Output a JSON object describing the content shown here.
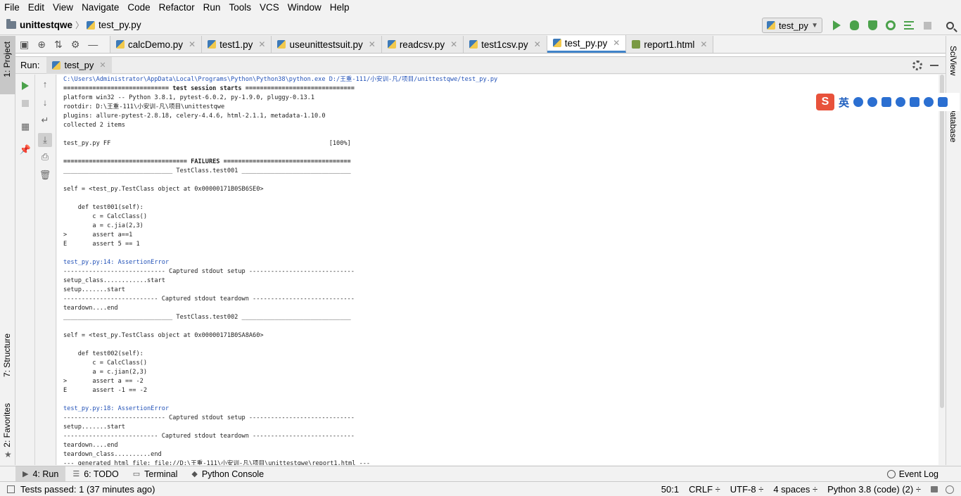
{
  "menu": [
    "File",
    "Edit",
    "View",
    "Navigate",
    "Code",
    "Refactor",
    "Run",
    "Tools",
    "VCS",
    "Window",
    "Help"
  ],
  "breadcrumb": {
    "project": "unittestqwe",
    "file": "test_py.py"
  },
  "run_config": {
    "label": "test_py"
  },
  "left_strip": {
    "project": "1: Project",
    "structure": "7: Structure",
    "favorites": "2: Favorites"
  },
  "right_strip": {
    "sciview": "SciView",
    "database": "Database"
  },
  "editor_tabs": [
    {
      "label": "calcDemo.py",
      "icon": "python-file-icon"
    },
    {
      "label": "test1.py",
      "icon": "python-file-icon"
    },
    {
      "label": "useunittestsuit.py",
      "icon": "python-file-icon"
    },
    {
      "label": "readcsv.py",
      "icon": "python-file-icon"
    },
    {
      "label": "test1csv.py",
      "icon": "python-file-icon"
    },
    {
      "label": "test_py.py",
      "icon": "python-file-icon",
      "active": true
    },
    {
      "label": "report1.html",
      "icon": "html-file-icon"
    }
  ],
  "run_panel": {
    "label": "Run:",
    "tab": "test_py"
  },
  "console_lines": [
    {
      "t": "C:\\Users\\Administrator\\AppData\\Local\\Programs\\Python\\Python38\\python.exe D:/王重-111/小安训-凡/项目/unittestqwe/test_py.py",
      "c": "link"
    },
    {
      "t": "============================= test session starts ==============================",
      "c": "bold"
    },
    {
      "t": "platform win32 -- Python 3.8.1, pytest-6.0.2, py-1.9.0, pluggy-0.13.1",
      "c": ""
    },
    {
      "t": "rootdir: D:\\王重-111\\小安训-凡\\项目\\unittestqwe",
      "c": ""
    },
    {
      "t": "plugins: allure-pytest-2.8.18, celery-4.4.6, html-2.1.1, metadata-1.10.0",
      "c": ""
    },
    {
      "t": "collected 2 items",
      "c": ""
    },
    {
      "t": "",
      "c": ""
    },
    {
      "t": "test_py.py FF                                                            [100%]",
      "c": ""
    },
    {
      "t": "",
      "c": ""
    },
    {
      "t": "================================== FAILURES ===================================",
      "c": "bold"
    },
    {
      "t": "______________________________ TestClass.test001 ______________________________",
      "c": ""
    },
    {
      "t": "",
      "c": ""
    },
    {
      "t": "self = <test_py.TestClass object at 0x00000171B0SB6SE0>",
      "c": ""
    },
    {
      "t": "",
      "c": ""
    },
    {
      "t": "    def test001(self):",
      "c": ""
    },
    {
      "t": "        c = CalcClass()",
      "c": ""
    },
    {
      "t": "        a = c.jia(2,3)",
      "c": ""
    },
    {
      "t": ">       assert a==1",
      "c": ""
    },
    {
      "t": "E       assert 5 == 1",
      "c": ""
    },
    {
      "t": "",
      "c": ""
    },
    {
      "t": "test_py.py:14: AssertionError",
      "c": "link-head"
    },
    {
      "t": "---------------------------- Captured stdout setup -----------------------------",
      "c": ""
    },
    {
      "t": "setup_class............start",
      "c": ""
    },
    {
      "t": "setup.......start",
      "c": ""
    },
    {
      "t": "-------------------------- Captured stdout teardown ----------------------------",
      "c": ""
    },
    {
      "t": "teardown....end",
      "c": ""
    },
    {
      "t": "______________________________ TestClass.test002 ______________________________",
      "c": ""
    },
    {
      "t": "",
      "c": ""
    },
    {
      "t": "self = <test_py.TestClass object at 0x00000171B0SA8A60>",
      "c": ""
    },
    {
      "t": "",
      "c": ""
    },
    {
      "t": "    def test002(self):",
      "c": ""
    },
    {
      "t": "        c = CalcClass()",
      "c": ""
    },
    {
      "t": "        a = c.jian(2,3)",
      "c": ""
    },
    {
      "t": ">       assert a == -2",
      "c": ""
    },
    {
      "t": "E       assert -1 == -2",
      "c": ""
    },
    {
      "t": "",
      "c": ""
    },
    {
      "t": "test_py.py:18: AssertionError",
      "c": "link-head"
    },
    {
      "t": "---------------------------- Captured stdout setup -----------------------------",
      "c": ""
    },
    {
      "t": "setup.......start",
      "c": ""
    },
    {
      "t": "-------------------------- Captured stdout teardown ----------------------------",
      "c": ""
    },
    {
      "t": "teardown....end",
      "c": ""
    },
    {
      "t": "teardown_class..........end",
      "c": ""
    },
    {
      "t": "--- generated html file: file://D:\\王重-111\\小安训-凡\\项目\\unittestqwe\\report1.html ---",
      "c": ""
    }
  ],
  "ime_bar": {
    "logo": "S",
    "lang": "英"
  },
  "bottom_tabs": [
    {
      "label": "4: Run",
      "icon": "run-icon",
      "active": true
    },
    {
      "label": "6: TODO",
      "icon": "todo-icon"
    },
    {
      "label": "Terminal",
      "icon": "terminal-icon"
    },
    {
      "label": "Python Console",
      "icon": "python-console-icon"
    }
  ],
  "event_log": "Event Log",
  "status": {
    "message": "Tests passed: 1 (37 minutes ago)",
    "position": "50:1",
    "line_sep": "CRLF ÷",
    "encoding": "UTF-8 ÷",
    "indent": "4 spaces ÷",
    "interpreter": "Python 3.8 (code) (2) ÷"
  },
  "colors": {
    "accent": "#4083c9",
    "run_green": "#4ba24b",
    "link": "#2453b8"
  }
}
